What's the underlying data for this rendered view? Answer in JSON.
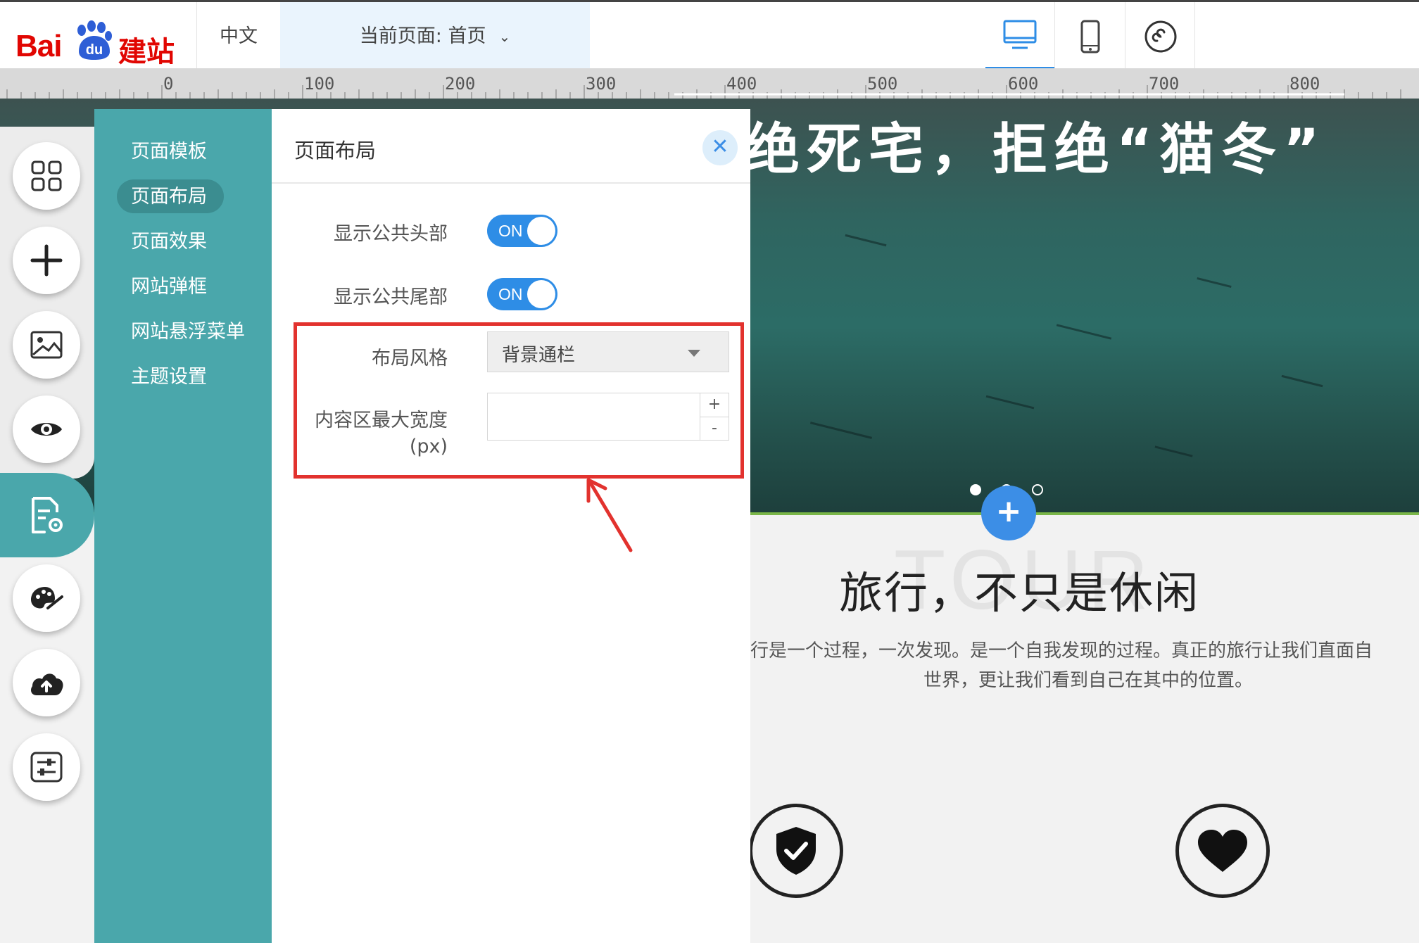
{
  "brand": {
    "logo_prefix": "Bai",
    "logo_mark": "du",
    "logo_suffix": "建站",
    "brand_color": "#e10602"
  },
  "topbar": {
    "language": "中文",
    "current_page": "当前页面: 首页",
    "devices": [
      {
        "icon": "desktop-icon",
        "active": true
      },
      {
        "icon": "mobile-icon",
        "active": false
      },
      {
        "icon": "mini-program-icon",
        "active": false
      }
    ]
  },
  "ruler": {
    "labels": [
      "0",
      "100",
      "200",
      "300",
      "400",
      "500",
      "600",
      "700",
      "800"
    ]
  },
  "toolbar": {
    "tools": [
      {
        "name": "modules",
        "icon": "grid-icon"
      },
      {
        "name": "add",
        "icon": "plus-icon"
      },
      {
        "name": "media",
        "icon": "image-icon"
      },
      {
        "name": "preview",
        "icon": "eye-icon"
      },
      {
        "name": "page-settings",
        "icon": "page-settings-icon",
        "active": true
      },
      {
        "name": "theme",
        "icon": "palette-icon"
      },
      {
        "name": "publish",
        "icon": "cloud-upload-icon"
      },
      {
        "name": "controls",
        "icon": "sliders-icon"
      }
    ]
  },
  "menu": {
    "items": [
      "页面模板",
      "页面布局",
      "页面效果",
      "网站弹框",
      "网站悬浮菜单",
      "主题设置"
    ],
    "active_index": 1,
    "accent_color": "#4aa7ab"
  },
  "panel": {
    "title": "页面布局",
    "show_header": {
      "label": "显示公共头部",
      "state": "ON"
    },
    "show_footer": {
      "label": "显示公共尾部",
      "state": "ON"
    },
    "layout_style": {
      "label": "布局风格",
      "value": "背景通栏"
    },
    "max_width": {
      "label_line1": "内容区最大宽度",
      "label_line2": "(px)",
      "value": "",
      "plus": "+",
      "minus": "-"
    }
  },
  "canvas": {
    "hero_title": "绝死宅，拒绝“猫冬”",
    "section_bg_text": "TOUR",
    "section_title": "旅行，不只是休闲",
    "section_desc_line1": "行是一个过程，一次发现。是一个自我发现的过程。真正的旅行让我们直面自",
    "section_desc_line2": "世界，更让我们看到自己在其中的位置。",
    "features": [
      {
        "icon": "shield-check-icon"
      },
      {
        "icon": "heart-icon"
      }
    ]
  },
  "annotation": {
    "highlight_color": "#e2322e"
  }
}
